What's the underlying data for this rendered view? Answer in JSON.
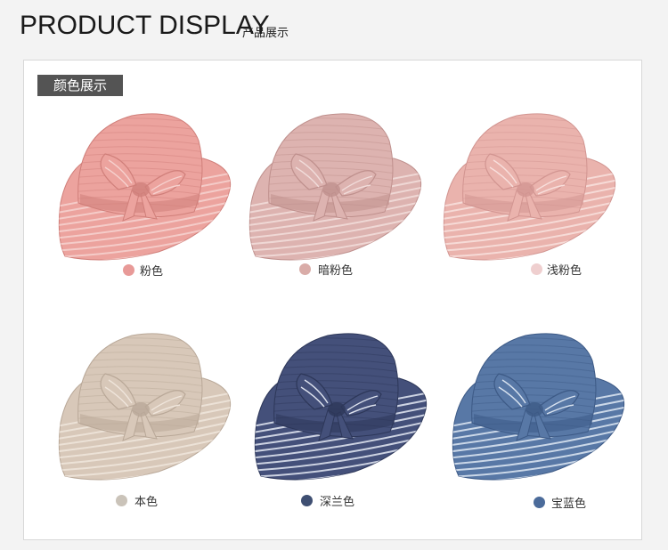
{
  "header": {
    "title": "PRODUCT DISPLAY",
    "subtitle": "产品展示"
  },
  "section": {
    "tag": "颜色展示"
  },
  "colors": [
    {
      "label": "粉色",
      "dot": "#e89a98",
      "hat": "#eca39e",
      "stripe": "#f6d1ce",
      "dark": "#d07f7a"
    },
    {
      "label": "暗粉色",
      "dot": "#d9aca8",
      "hat": "#ddb3b0",
      "stripe": "#f1dcda",
      "dark": "#bf908d"
    },
    {
      "label": "浅粉色",
      "dot": "#efcfcf",
      "hat": "#eab3ad",
      "stripe": "#f8dfdc",
      "dark": "#d29591"
    },
    {
      "label": "本色",
      "dot": "#cac3b9",
      "hat": "#d8c8b9",
      "stripe": "#efe5db",
      "dark": "#b9a898"
    },
    {
      "label": "深兰色",
      "dot": "#3f4f72",
      "hat": "#44507a",
      "stripe": "#dde2ee",
      "dark": "#2d3759"
    },
    {
      "label": "宝蓝色",
      "dot": "#4b6b9a",
      "hat": "#5878a6",
      "stripe": "#d9e3f0",
      "dark": "#3d5a86"
    }
  ]
}
